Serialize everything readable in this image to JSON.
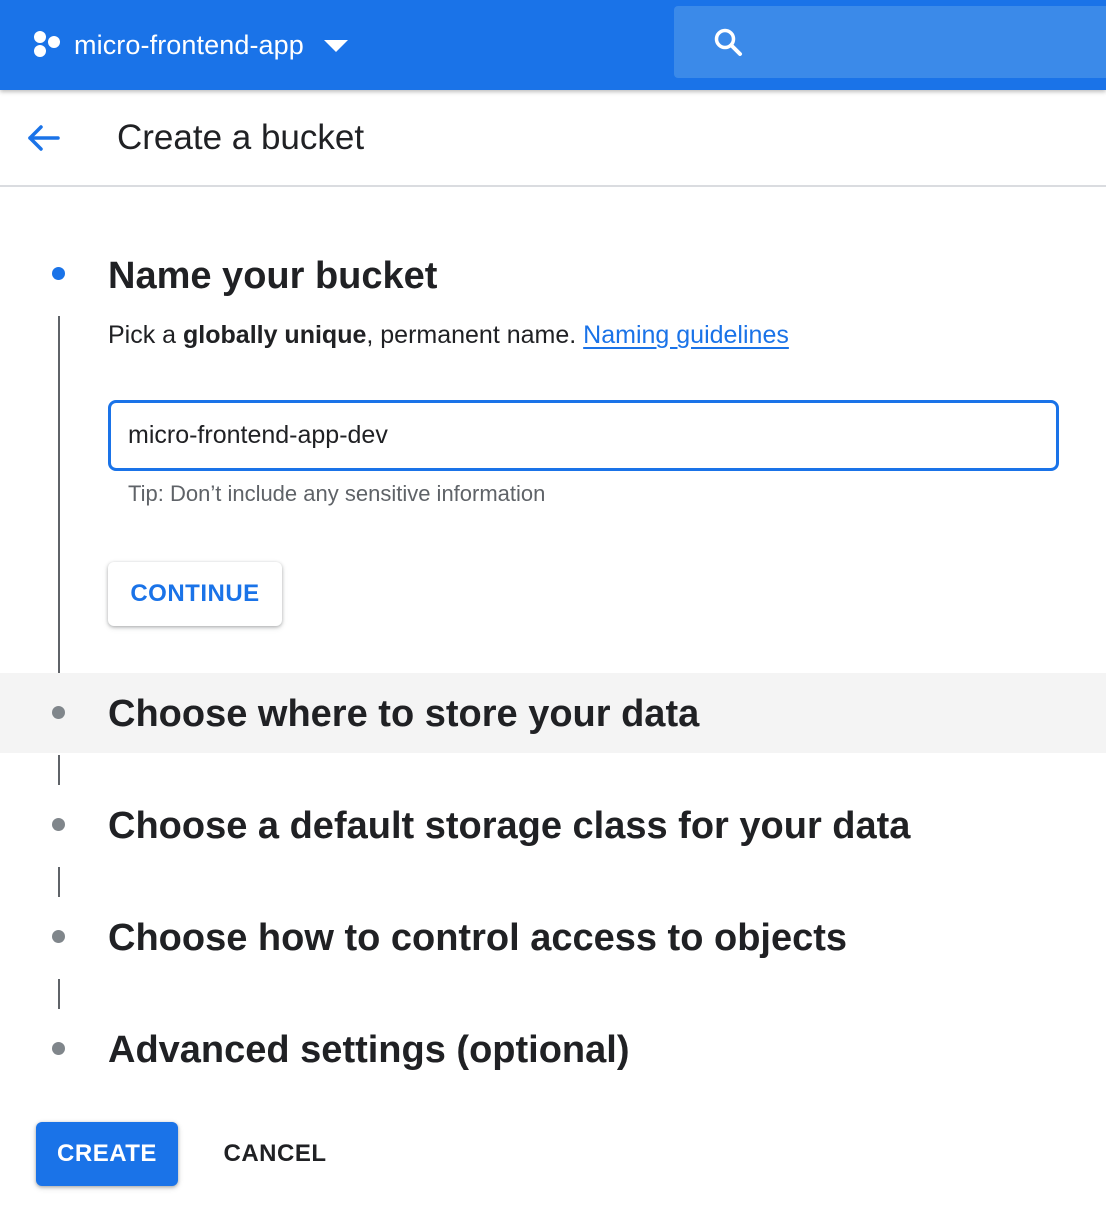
{
  "topbar": {
    "project_name": "micro-frontend-app",
    "project_icon": "hexagon-cluster-icon",
    "dropdown_icon": "caret-down-icon",
    "search_icon": "search-icon",
    "color": "#1a73e8"
  },
  "header": {
    "back_icon": "arrow-back-icon",
    "title": "Create a bucket"
  },
  "steps": [
    {
      "title": "Name your bucket",
      "state": "active",
      "description": {
        "prefix": "Pick a ",
        "emphasis": "globally unique",
        "suffix": ", permanent name. ",
        "link": "Naming guidelines"
      },
      "input_value": "micro-frontend-app-dev",
      "tip": "Tip: Don’t include any sensitive information",
      "continue_label": "CONTINUE"
    },
    {
      "title": "Choose where to store your data",
      "state": "hover"
    },
    {
      "title": "Choose a default storage class for your data",
      "state": "inactive"
    },
    {
      "title": "Choose how to control access to objects",
      "state": "inactive"
    },
    {
      "title": "Advanced settings (optional)",
      "state": "inactive"
    }
  ],
  "actions": {
    "create_label": "CREATE",
    "cancel_label": "CANCEL"
  },
  "colors": {
    "accent": "#1a73e8",
    "step_inactive": "#80868b",
    "hover_row": "#f4f4f4"
  }
}
